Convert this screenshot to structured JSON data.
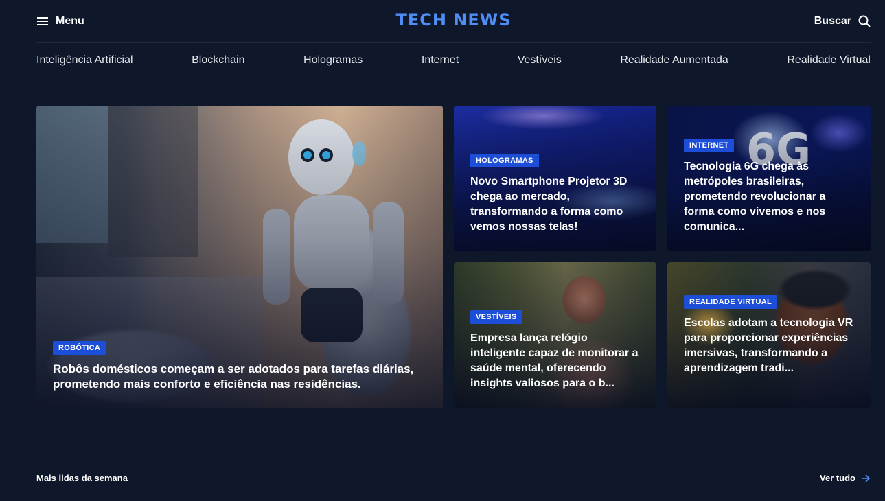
{
  "header": {
    "menu_label": "Menu",
    "logo": "TECH NEWS",
    "search_label": "Buscar"
  },
  "nav": {
    "items": [
      "Inteligência Artificial",
      "Blockchain",
      "Hologramas",
      "Internet",
      "Vestíveis",
      "Realidade Aumentada",
      "Realidade Virtual"
    ]
  },
  "featured": {
    "tag": "ROBÓTICA",
    "title": "Robôs domésticos começam a ser adotados para tarefas diárias, prometendo mais conforto e eficiência nas residências."
  },
  "cards": [
    {
      "tag": "HOLOGRAMAS",
      "title": "Novo Smartphone Projetor 3D chega ao mercado, transformando a forma como vemos nossas telas!"
    },
    {
      "tag": "INTERNET",
      "title": "Tecnologia 6G chega às metrópoles brasileiras, prometendo revolucionar a forma como vivemos e nos comunica..."
    },
    {
      "tag": "VESTÍVEIS",
      "title": "Empresa lança relógio inteligente capaz de monitorar a saúde mental, oferecendo insights valiosos para o b..."
    },
    {
      "tag": "REALIDADE VIRTUAL",
      "title": "Escolas adotam a tecnologia VR para proporcionar experiências imersivas, transformando a aprendizagem tradi..."
    }
  ],
  "section": {
    "title": "Mais lidas da semana",
    "see_all": "Ver tudo"
  },
  "colors": {
    "background": "#0f172a",
    "accent": "#4f8ef7",
    "tag": "#1d4ed8"
  },
  "icons": {
    "menu": "hamburger-icon",
    "search": "search-icon",
    "see_all": "arrow-right-icon"
  }
}
